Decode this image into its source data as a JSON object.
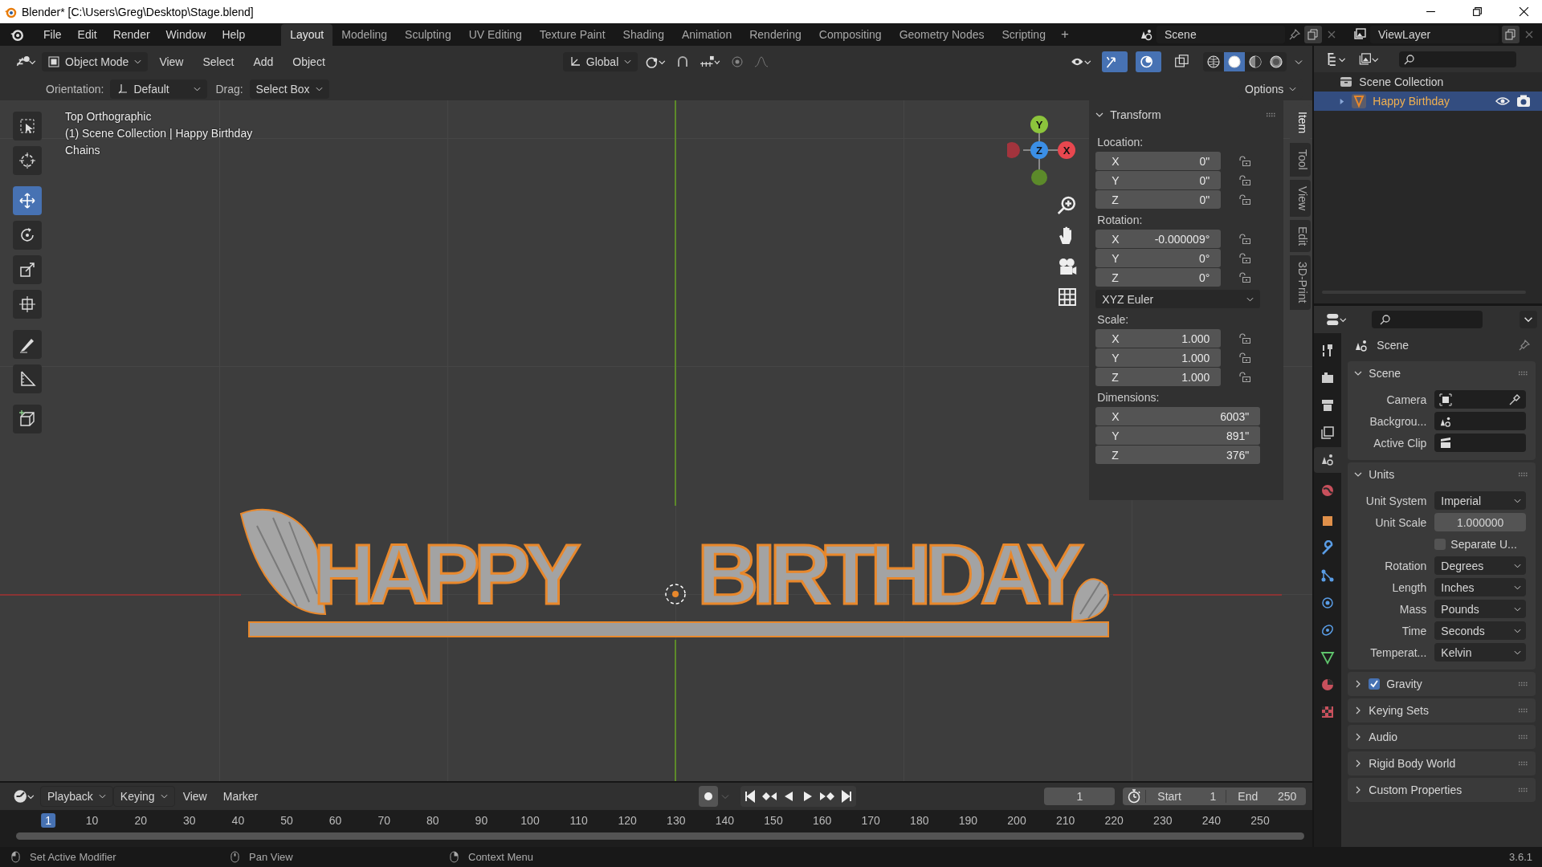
{
  "window": {
    "title": "Blender* [C:\\Users\\Greg\\Desktop\\Stage.blend]"
  },
  "menu": [
    "File",
    "Edit",
    "Render",
    "Window",
    "Help"
  ],
  "workspaces": [
    {
      "label": "Layout",
      "selected": true
    },
    {
      "label": "Modeling",
      "selected": false
    },
    {
      "label": "Sculpting",
      "selected": false
    },
    {
      "label": "UV Editing",
      "selected": false
    },
    {
      "label": "Texture Paint",
      "selected": false
    },
    {
      "label": "Shading",
      "selected": false
    },
    {
      "label": "Animation",
      "selected": false
    },
    {
      "label": "Rendering",
      "selected": false
    },
    {
      "label": "Compositing",
      "selected": false
    },
    {
      "label": "Geometry Nodes",
      "selected": false
    },
    {
      "label": "Scripting",
      "selected": false
    }
  ],
  "workspace_add": "+",
  "scene": {
    "value": "Scene"
  },
  "view_layer": {
    "value": "ViewLayer"
  },
  "viewport_header": {
    "mode": "Object Mode",
    "menus": [
      "View",
      "Select",
      "Add",
      "Object"
    ],
    "orientation": "Global",
    "show_gizmos": true,
    "show_overlays": true,
    "xray": false,
    "shading": [
      {
        "selected": false
      },
      {
        "selected": true
      },
      {
        "selected": false
      },
      {
        "selected": false
      }
    ]
  },
  "tool_settings": {
    "orientation_label": "Orientation:",
    "orientation": "Default",
    "drag_label": "Drag:",
    "drag": "Select Box",
    "options": "Options"
  },
  "viewport": {
    "info": [
      "Top Orthographic",
      "(1) Scene Collection | Happy Birthday",
      "Chains"
    ],
    "object_text": [
      "HAPPY",
      "BIRTHDAY"
    ],
    "gizmo": [
      {
        "label": "Y",
        "color": "#8cc43c"
      },
      {
        "label": "Z",
        "color": "#3b8fe6"
      },
      {
        "label": "X",
        "color": "#e8474f"
      }
    ]
  },
  "tools": [
    {
      "selected": false
    },
    {
      "selected": false
    },
    {
      "selected": true
    },
    {
      "selected": false
    },
    {
      "selected": false
    },
    {
      "selected": false
    },
    {
      "selected": false
    },
    {
      "selected": false
    },
    {
      "selected": false
    }
  ],
  "n_panel": {
    "title": "Transform",
    "groups": [
      {
        "label": "Location:",
        "fields": [
          {
            "axis": "X",
            "value": "0\""
          },
          {
            "axis": "Y",
            "value": "0\""
          },
          {
            "axis": "Z",
            "value": "0\""
          }
        ]
      },
      {
        "label": "Rotation:",
        "fields": [
          {
            "axis": "X",
            "value": "-0.000009°"
          },
          {
            "axis": "Y",
            "value": "0°"
          },
          {
            "axis": "Z",
            "value": "0°"
          }
        ]
      },
      {
        "label": "Scale:",
        "fields": [
          {
            "axis": "X",
            "value": "1.000"
          },
          {
            "axis": "Y",
            "value": "1.000"
          },
          {
            "axis": "Z",
            "value": "1.000"
          }
        ]
      },
      {
        "label": "Dimensions:",
        "fields": [
          {
            "axis": "X",
            "value": "6003\""
          },
          {
            "axis": "Y",
            "value": "891\""
          },
          {
            "axis": "Z",
            "value": "376\""
          }
        ]
      }
    ],
    "rotation_mode": "XYZ Euler",
    "tabs": [
      {
        "label": "Item",
        "selected": true
      },
      {
        "label": "Tool",
        "selected": false
      },
      {
        "label": "View",
        "selected": false
      },
      {
        "label": "Edit",
        "selected": false
      },
      {
        "label": "3D-Print",
        "selected": false
      }
    ]
  },
  "outliner": {
    "root": "Scene Collection",
    "children": [
      {
        "label": "Happy Birthday",
        "selected": true,
        "expanded": false
      }
    ]
  },
  "properties": {
    "header": "Scene",
    "tabs": [
      {
        "selected": false
      },
      {
        "selected": false
      },
      {
        "selected": false
      },
      {
        "selected": false
      },
      {
        "selected": true
      },
      {
        "selected": false
      },
      {
        "selected": false
      },
      {
        "selected": false
      },
      {
        "selected": false
      },
      {
        "selected": false
      },
      {
        "selected": false
      },
      {
        "selected": false
      },
      {
        "selected": false
      },
      {
        "selected": false
      }
    ],
    "panels": [
      {
        "title": "Scene",
        "expanded": true,
        "rows": [
          {
            "kind": "object",
            "label": "Camera"
          },
          {
            "kind": "object",
            "label": "Backgrou..."
          },
          {
            "kind": "object",
            "label": "Active Clip"
          }
        ]
      },
      {
        "title": "Units",
        "expanded": true,
        "rows": [
          {
            "kind": "dropdown",
            "label": "Unit System",
            "value": "Imperial"
          },
          {
            "kind": "number",
            "label": "Unit Scale",
            "value": "1.000000"
          },
          {
            "kind": "checkbox",
            "label": "Separate U...",
            "checked": false
          },
          {
            "kind": "dropdown",
            "label": "Rotation",
            "value": "Degrees"
          },
          {
            "kind": "dropdown",
            "label": "Length",
            "value": "Inches"
          },
          {
            "kind": "dropdown",
            "label": "Mass",
            "value": "Pounds"
          },
          {
            "kind": "dropdown",
            "label": "Time",
            "value": "Seconds"
          },
          {
            "kind": "dropdown",
            "label": "Temperat...",
            "value": "Kelvin"
          }
        ]
      },
      {
        "title": "Gravity",
        "expanded": false,
        "checked": true
      },
      {
        "title": "Keying Sets",
        "expanded": false
      },
      {
        "title": "Audio",
        "expanded": false
      },
      {
        "title": "Rigid Body World",
        "expanded": false
      },
      {
        "title": "Custom Properties",
        "expanded": false
      }
    ]
  },
  "timeline": {
    "menus": [
      "Playback",
      "Keying",
      "View",
      "Marker"
    ],
    "current_frame": "1",
    "start_label": "Start",
    "start": "1",
    "end_label": "End",
    "end": "250",
    "ticks": [
      {
        "label": "1",
        "current": true
      },
      {
        "label": "10",
        "current": false
      },
      {
        "label": "20",
        "current": false
      },
      {
        "label": "30",
        "current": false
      },
      {
        "label": "40",
        "current": false
      },
      {
        "label": "50",
        "current": false
      },
      {
        "label": "60",
        "current": false
      },
      {
        "label": "70",
        "current": false
      },
      {
        "label": "80",
        "current": false
      },
      {
        "label": "90",
        "current": false
      },
      {
        "label": "100",
        "current": false
      },
      {
        "label": "110",
        "current": false
      },
      {
        "label": "120",
        "current": false
      },
      {
        "label": "130",
        "current": false
      },
      {
        "label": "140",
        "current": false
      },
      {
        "label": "150",
        "current": false
      },
      {
        "label": "160",
        "current": false
      },
      {
        "label": "170",
        "current": false
      },
      {
        "label": "180",
        "current": false
      },
      {
        "label": "190",
        "current": false
      },
      {
        "label": "200",
        "current": false
      },
      {
        "label": "210",
        "current": false
      },
      {
        "label": "220",
        "current": false
      },
      {
        "label": "230",
        "current": false
      },
      {
        "label": "240",
        "current": false
      },
      {
        "label": "250",
        "current": false
      }
    ]
  },
  "status_bar": {
    "hints": [
      "Set Active Modifier",
      "Pan View",
      "Context Menu"
    ],
    "version": "3.6.1"
  }
}
